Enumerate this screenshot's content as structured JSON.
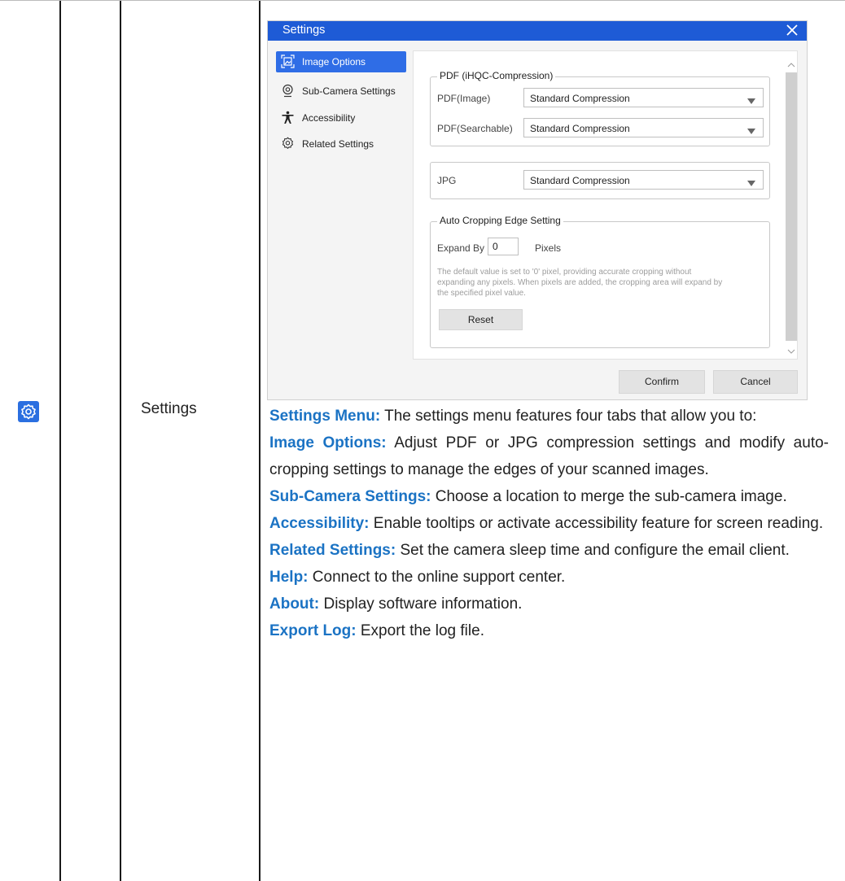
{
  "row": {
    "icon": "gear-icon",
    "feature_name": "Settings",
    "accent_color": "#1b73c4"
  },
  "dialog": {
    "title": "Settings",
    "title_bar_color": "#1e5bd6",
    "nav": [
      {
        "label": "Image Options",
        "icon": "image-crop-icon",
        "active": true
      },
      {
        "label": "Sub-Camera Settings",
        "icon": "webcam-icon",
        "active": false
      },
      {
        "label": "Accessibility",
        "icon": "accessibility-person-icon",
        "active": false
      },
      {
        "label": "Related Settings",
        "icon": "gear-icon",
        "active": false
      }
    ],
    "pdf_group": {
      "legend": "PDF (iHQC-Compression)",
      "rows": [
        {
          "label": "PDF(Image)",
          "value": "Standard Compression"
        },
        {
          "label": "PDF(Searchable)",
          "value": "Standard Compression"
        }
      ]
    },
    "jpg": {
      "label": "JPG",
      "value": "Standard Compression"
    },
    "crop_group": {
      "legend": "Auto Cropping Edge Setting",
      "expand_label": "Expand By",
      "expand_value": "0",
      "unit": "Pixels",
      "hint_lines": [
        "The default value is set to '0' pixel, providing accurate cropping without",
        "expanding any pixels. When pixels are added, the cropping area will expand by",
        "the specified pixel value."
      ],
      "reset_label": "Reset"
    },
    "confirm_label": "Confirm",
    "cancel_label": "Cancel"
  },
  "description": [
    {
      "term": "Settings Menu:",
      "text": " The settings menu features four tabs that allow you to:"
    },
    {
      "term": "Image Options:",
      "text": " Adjust PDF or JPG compression settings and modify auto-cropping settings to manage the edges of your scanned images."
    },
    {
      "term": "Sub-Camera Settings:",
      "text": " Choose a location to merge the sub-camera image."
    },
    {
      "term": "Accessibility:",
      "text": " Enable tooltips or activate accessibility feature for screen reading."
    },
    {
      "term": "Related Settings:",
      "text": " Set the camera sleep time and configure the email client."
    },
    {
      "term": "Help:",
      "text": " Connect to the online support center."
    },
    {
      "term": "About:",
      "text": " Display software information."
    },
    {
      "term": "Export Log:",
      "text": " Export the log file."
    }
  ]
}
